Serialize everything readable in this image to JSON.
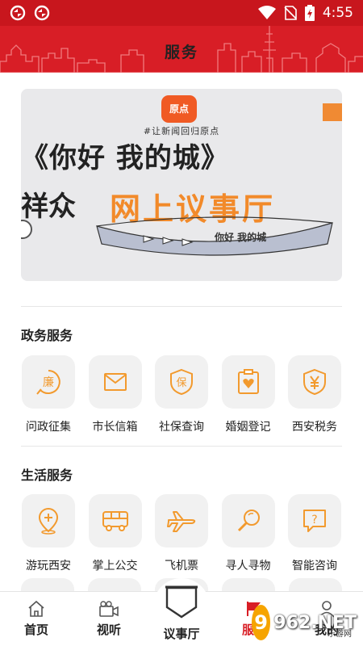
{
  "status_bar": {
    "time": "4:55"
  },
  "header": {
    "title": "服务"
  },
  "banner": {
    "logo_text": "原点",
    "tagline": "#让新闻回归原点",
    "headline": "《你好  我的城》",
    "left_text": "祥众",
    "highlight": "网上议事厅",
    "subtitle": "你好  我的城"
  },
  "sections": [
    {
      "title": "政务服务",
      "items": [
        {
          "label": "问政征集",
          "icon": "lian-badge-icon"
        },
        {
          "label": "市长信箱",
          "icon": "mail-icon"
        },
        {
          "label": "社保查询",
          "icon": "shield-bao-icon"
        },
        {
          "label": "婚姻登记",
          "icon": "heart-certificate-icon"
        },
        {
          "label": "西安税务",
          "icon": "yen-shield-icon"
        }
      ]
    },
    {
      "title": "生活服务",
      "items": [
        {
          "label": "游玩西安",
          "icon": "location-plus-icon"
        },
        {
          "label": "掌上公交",
          "icon": "bus-icon"
        },
        {
          "label": "飞机票",
          "icon": "airplane-icon"
        },
        {
          "label": "寻人寻物",
          "icon": "magnifier-icon"
        },
        {
          "label": "智能咨询",
          "icon": "question-bubble-icon"
        }
      ]
    }
  ],
  "bottom_nav": [
    {
      "label": "首页",
      "icon": "home-icon"
    },
    {
      "label": "视听",
      "icon": "video-camera-icon"
    },
    {
      "label": "议事厅",
      "icon": "banner-flag-icon"
    },
    {
      "label": "服务",
      "icon": "service-flag-icon"
    },
    {
      "label": "我的",
      "icon": "user-icon"
    }
  ],
  "watermark": {
    "badge": "9",
    "text": "962.NET",
    "sub": "乐游网"
  },
  "colors": {
    "brand_red": "#d81e26",
    "accent_orange": "#f29a2e",
    "tile_bg": "#f1f1f1"
  }
}
